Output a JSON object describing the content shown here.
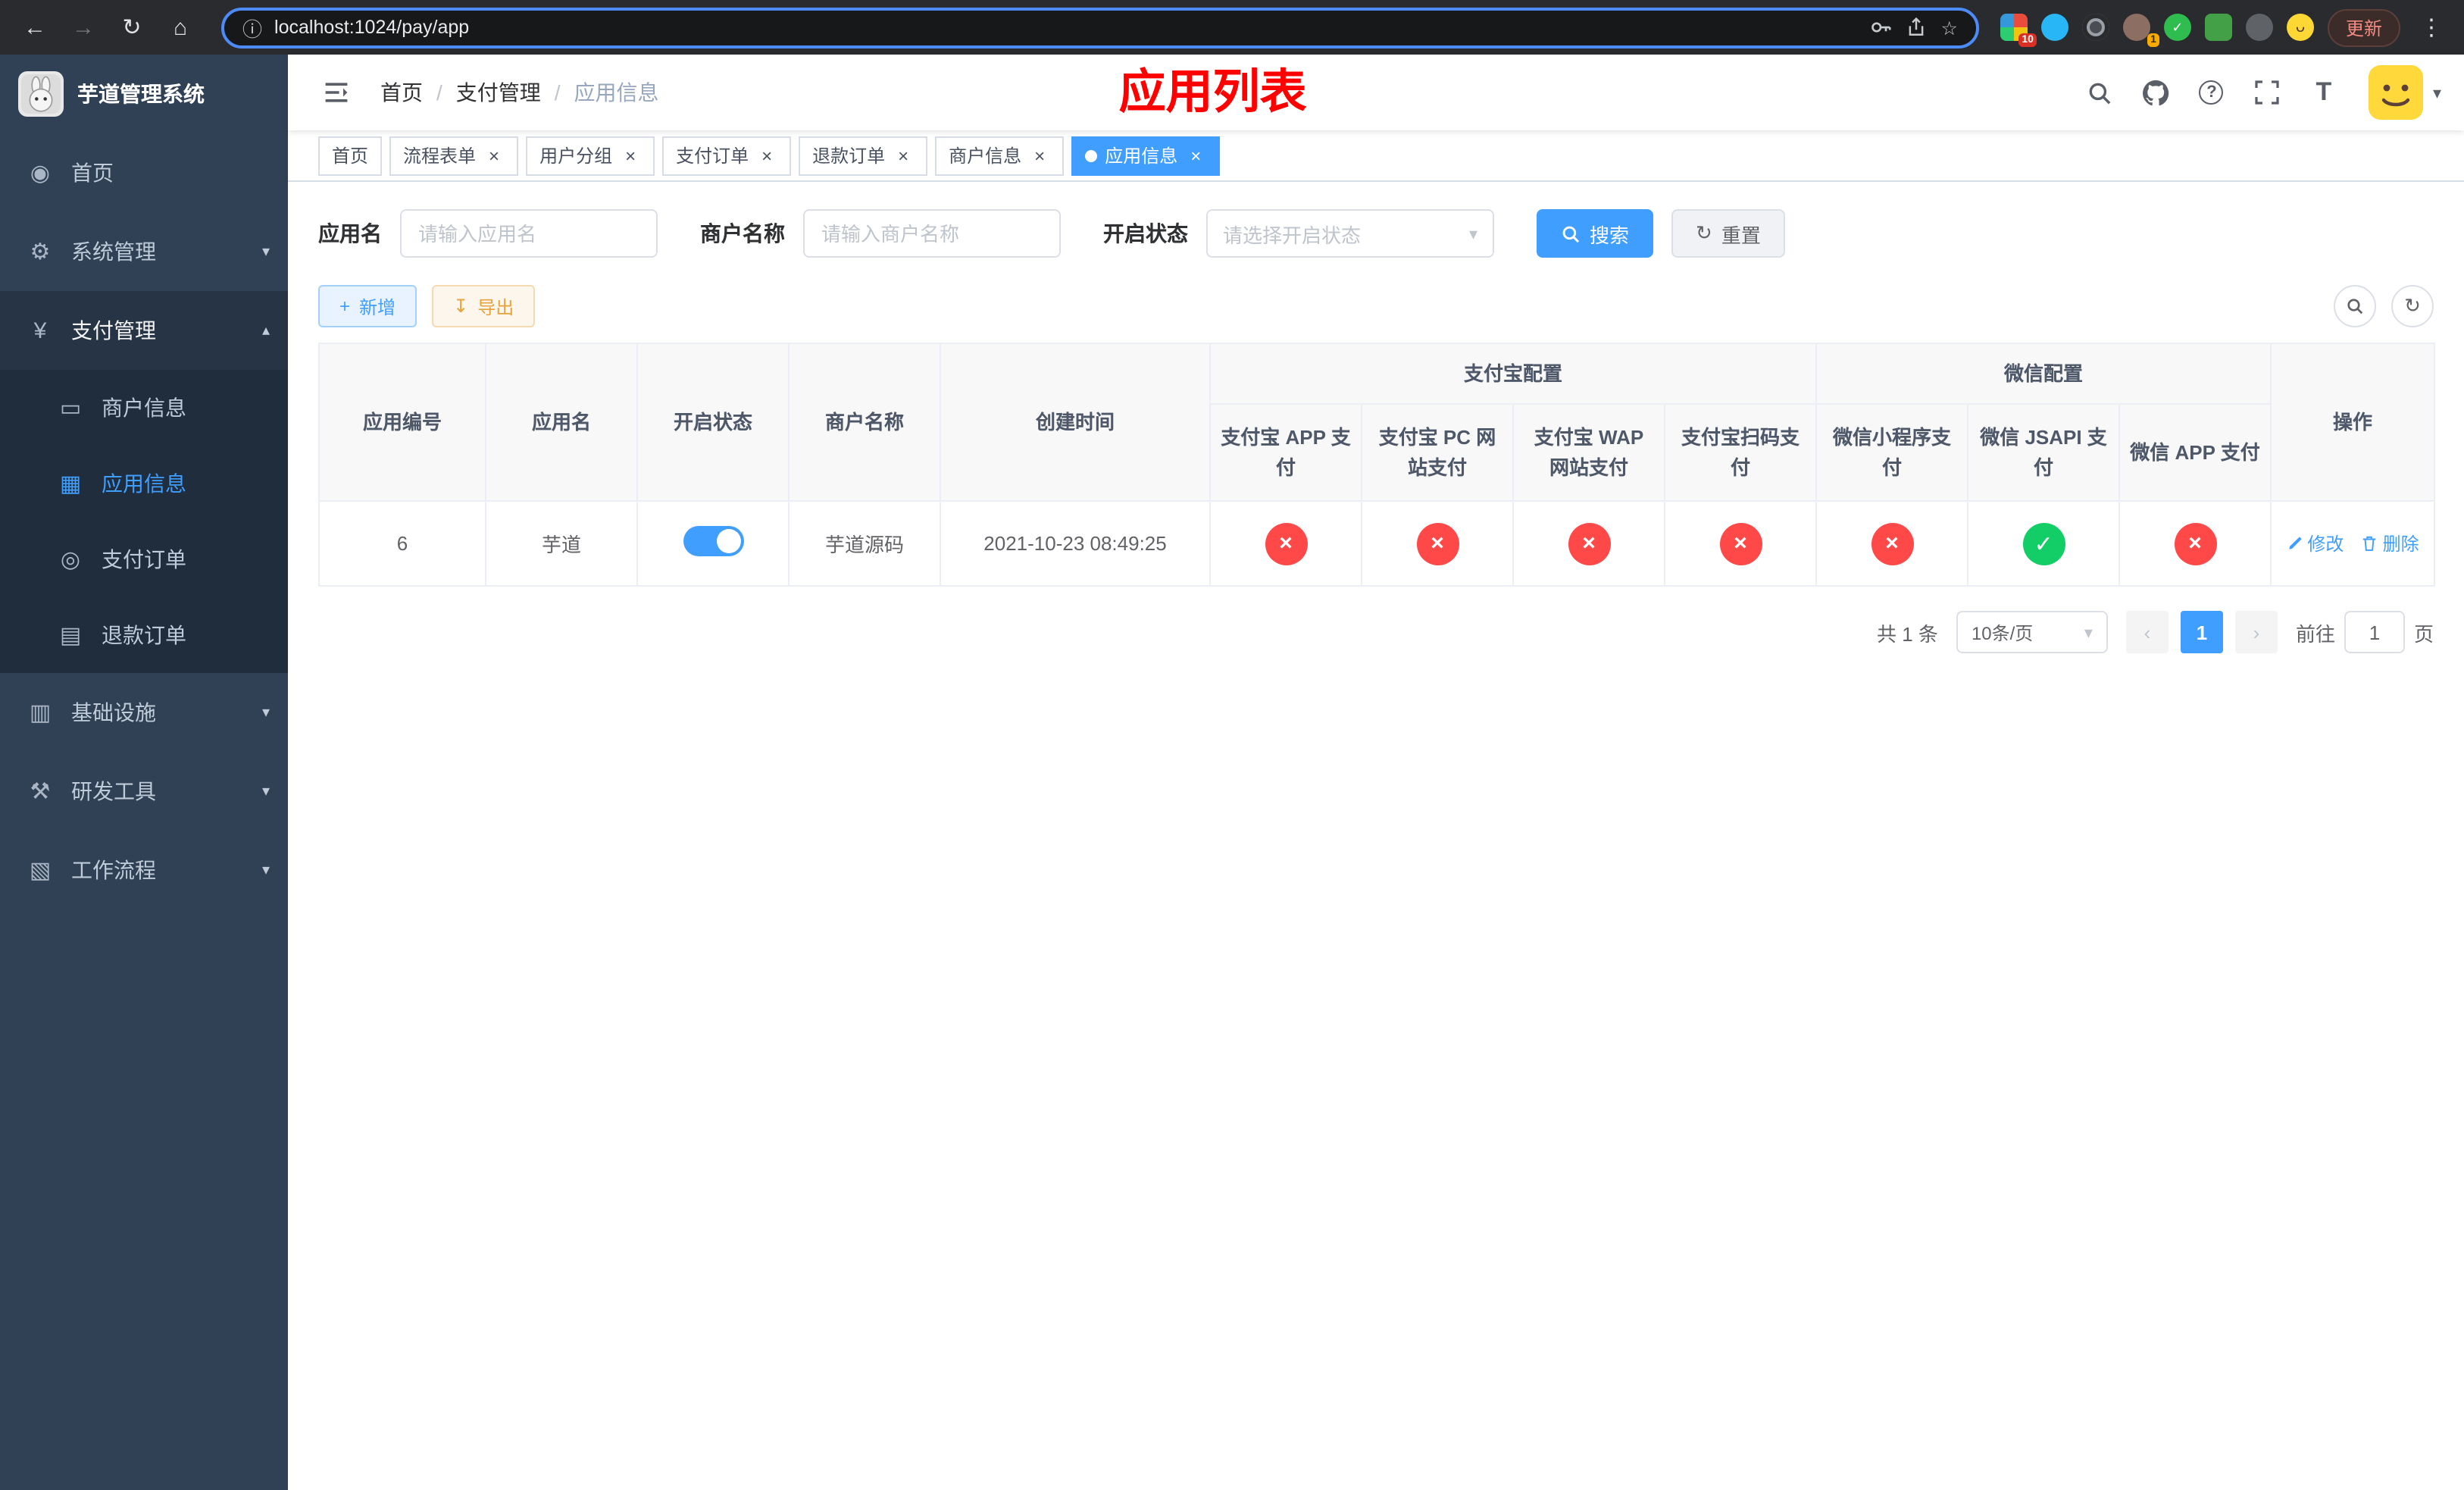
{
  "browser": {
    "url": "localhost:1024/pay/app",
    "update_label": "更新",
    "ext_badges": {
      "grid": "10",
      "avatar": "1"
    }
  },
  "icons": {
    "back": "←",
    "forward": "→",
    "reload": "↻",
    "home": "⌂",
    "info": "ⓘ",
    "star": "☆",
    "menu_dots": "⋮",
    "close": "×",
    "plus": "+",
    "download": "↧",
    "refresh": "↻",
    "chevron_down": "▾",
    "chevron_up": "▴",
    "caret_down": "▾",
    "help": "?",
    "text_size": "T",
    "prev": "‹",
    "next": "›",
    "sidebar_home": "◉",
    "sidebar_system": "⚙",
    "sidebar_pay": "¥",
    "sidebar_merchant": "▭",
    "sidebar_app": "▦",
    "sidebar_order": "◎",
    "sidebar_refund": "▤",
    "sidebar_infra": "▥",
    "sidebar_tools": "⚒",
    "sidebar_flow": "▧"
  },
  "colors": {
    "primary": "#409eff",
    "success": "#13ce66",
    "danger": "#ff4949",
    "warning": "#e6a23c",
    "annotation": "#ff0000",
    "sidebar_bg": "#304156",
    "submenu_bg": "#1f2d3d"
  },
  "sidebar": {
    "title": "芋道管理系统",
    "items": [
      {
        "label": "首页"
      },
      {
        "label": "系统管理"
      },
      {
        "label": "支付管理"
      },
      {
        "label": "基础设施"
      },
      {
        "label": "研发工具"
      },
      {
        "label": "工作流程"
      }
    ],
    "submenu": [
      {
        "label": "商户信息"
      },
      {
        "label": "应用信息"
      },
      {
        "label": "支付订单"
      },
      {
        "label": "退款订单"
      }
    ]
  },
  "header": {
    "breadcrumb": [
      "首页",
      "支付管理",
      "应用信息"
    ],
    "annotation": "应用列表"
  },
  "tabs": [
    {
      "label": "首页"
    },
    {
      "label": "流程表单"
    },
    {
      "label": "用户分组"
    },
    {
      "label": "支付订单"
    },
    {
      "label": "退款订单"
    },
    {
      "label": "商户信息"
    },
    {
      "label": "应用信息"
    }
  ],
  "filters": {
    "app_name_label": "应用名",
    "app_name_placeholder": "请输入应用名",
    "merchant_label": "商户名称",
    "merchant_placeholder": "请输入商户名称",
    "status_label": "开启状态",
    "status_placeholder": "请选择开启状态",
    "search_label": "搜索",
    "reset_label": "重置"
  },
  "toolbar": {
    "add_label": "新增",
    "export_label": "导出"
  },
  "table": {
    "headers": {
      "app_id": "应用编号",
      "app_name": "应用名",
      "status": "开启状态",
      "merchant": "商户名称",
      "created": "创建时间",
      "alipay_group": "支付宝配置",
      "wechat_group": "微信配置",
      "actions": "操作",
      "alipay_cols": [
        "支付宝 APP 支付",
        "支付宝 PC 网站支付",
        "支付宝 WAP 网站支付",
        "支付宝扫码支付"
      ],
      "wechat_cols": [
        "微信小程序支付",
        "微信 JSAPI 支付",
        "微信 APP 支付"
      ]
    },
    "rows": [
      {
        "id": "6",
        "name": "芋道",
        "enabled": true,
        "merchant": "芋道源码",
        "created": "2021-10-23 08:49:25",
        "configs": [
          false,
          false,
          false,
          false,
          false,
          true,
          false
        ],
        "edit_label": "修改",
        "delete_label": "删除"
      }
    ]
  },
  "pagination": {
    "total": "共 1 条",
    "page_size": "10条/页",
    "page": "1",
    "goto_prefix": "前往",
    "goto_suffix": "页",
    "goto_value": "1"
  }
}
